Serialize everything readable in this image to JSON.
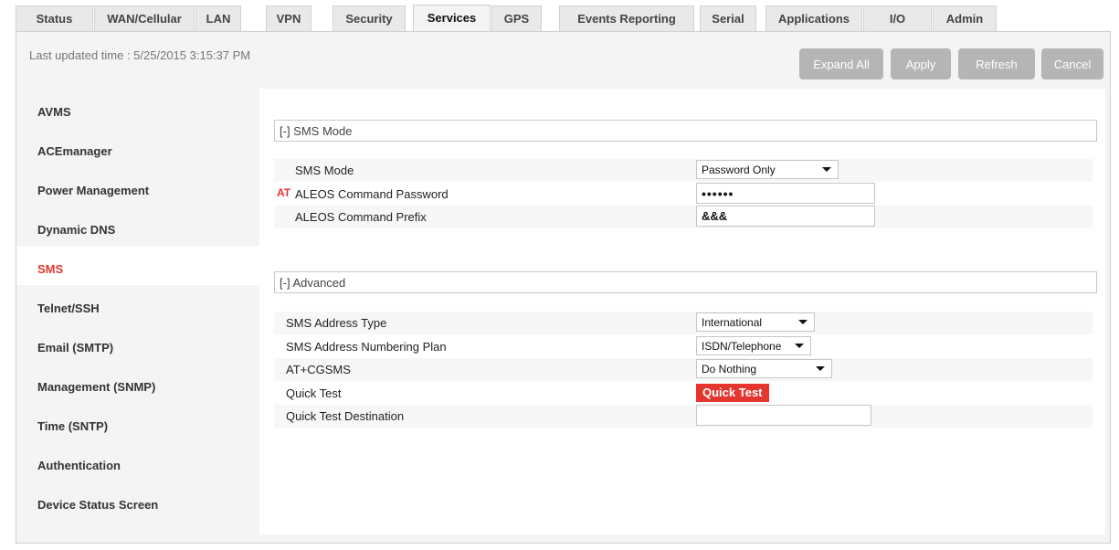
{
  "tabs": [
    {
      "label": "Status",
      "active": false
    },
    {
      "label": "WAN/Cellular",
      "active": false
    },
    {
      "label": "LAN",
      "active": false
    },
    {
      "label": "VPN",
      "active": false
    },
    {
      "label": "Security",
      "active": false
    },
    {
      "label": "Services",
      "active": true
    },
    {
      "label": "GPS",
      "active": false
    },
    {
      "label": "Events Reporting",
      "active": false
    },
    {
      "label": "Serial",
      "active": false
    },
    {
      "label": "Applications",
      "active": false
    },
    {
      "label": "I/O",
      "active": false
    },
    {
      "label": "Admin",
      "active": false
    }
  ],
  "header": {
    "last_updated": "Last updated time : 5/25/2015 3:15:37 PM"
  },
  "toolbar": {
    "expand_all": "Expand All",
    "apply": "Apply",
    "refresh": "Refresh",
    "cancel": "Cancel"
  },
  "sidebar": {
    "items": [
      {
        "label": "AVMS",
        "active": false
      },
      {
        "label": "ACEmanager",
        "active": false
      },
      {
        "label": "Power Management",
        "active": false
      },
      {
        "label": "Dynamic DNS",
        "active": false
      },
      {
        "label": "SMS",
        "active": true
      },
      {
        "label": "Telnet/SSH",
        "active": false
      },
      {
        "label": "Email (SMTP)",
        "active": false
      },
      {
        "label": "Management (SNMP)",
        "active": false
      },
      {
        "label": "Time (SNTP)",
        "active": false
      },
      {
        "label": "Authentication",
        "active": false
      },
      {
        "label": "Device Status Screen",
        "active": false
      }
    ]
  },
  "sms_mode_section": {
    "title": "[-] SMS Mode",
    "at_badge": "AT",
    "rows": {
      "sms_mode": {
        "label": "SMS Mode",
        "value": "Password Only"
      },
      "command_password": {
        "label": "ALEOS Command Password",
        "value": "••••••"
      },
      "command_prefix": {
        "label": "ALEOS Command Prefix",
        "value": "&&&"
      }
    }
  },
  "advanced_section": {
    "title": "[-] Advanced",
    "rows": {
      "address_type": {
        "label": "SMS Address Type",
        "value": "International"
      },
      "numbering_plan": {
        "label": "SMS Address Numbering Plan",
        "value": "ISDN/Telephone"
      },
      "cgsms": {
        "label": "AT+CGSMS",
        "value": "Do Nothing"
      },
      "quick_test": {
        "label": "Quick Test",
        "button": "Quick Test"
      },
      "quick_test_dest": {
        "label": "Quick Test Destination",
        "value": ""
      }
    }
  },
  "colors": {
    "accent": "#e4362e",
    "button_grey": "#b5b5b5",
    "panel_bg": "#f4f4f4"
  }
}
